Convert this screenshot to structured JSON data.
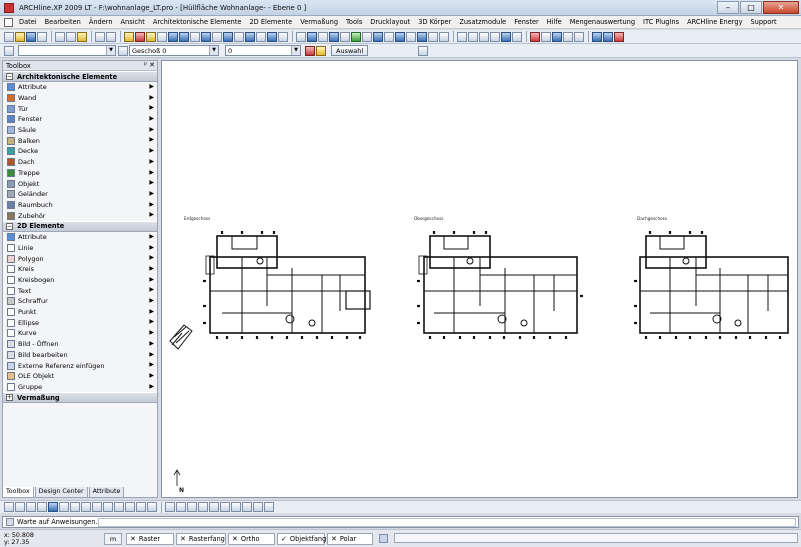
{
  "window": {
    "title": "ARCHline.XP 2009 LT - F:\\wohnanlage_LT.pro - [Hüllfläche Wohnanlage- - Ebene 0 ]",
    "controls": [
      "–",
      "□",
      "✕"
    ]
  },
  "menubar": {
    "items": [
      "Datei",
      "Bearbeiten",
      "Ändern",
      "Ansicht",
      "Architektonische Elemente",
      "2D Elemente",
      "Vermaßung",
      "Tools",
      "Drucklayout",
      "3D Körper",
      "Zusatzmodule",
      "Fenster",
      "Hilfe",
      "Mengenauswertung",
      "ITC PlugIns",
      "ARCHline Energy",
      "Support"
    ]
  },
  "toolbar2": {
    "floor_combo": "Geschoß 0",
    "layer_combo": "0",
    "selection_button": "Auswahl"
  },
  "toolbox": {
    "header": "Toolbox",
    "header_buttons": "ᵖ ✕",
    "groups": [
      {
        "title": "Architektonische Elemente",
        "toggle": "−",
        "items": [
          {
            "label": "Attribute",
            "icon": "attribute-icon",
            "color": "#5b8ed6"
          },
          {
            "label": "Wand",
            "icon": "wall-icon",
            "color": "#d36c2c"
          },
          {
            "label": "Tür",
            "icon": "door-icon",
            "color": "#7a9ad0"
          },
          {
            "label": "Fenster",
            "icon": "window-icon",
            "color": "#5a86c8"
          },
          {
            "label": "Säule",
            "icon": "column-icon",
            "color": "#9fb8de"
          },
          {
            "label": "Balken",
            "icon": "beam-icon",
            "color": "#c7b17a"
          },
          {
            "label": "Decke",
            "icon": "slab-icon",
            "color": "#3aa0a0"
          },
          {
            "label": "Dach",
            "icon": "roof-icon",
            "color": "#b0552a"
          },
          {
            "label": "Treppe",
            "icon": "stairs-icon",
            "color": "#3c8a3c"
          },
          {
            "label": "Objekt",
            "icon": "object-icon",
            "color": "#8a9ab3"
          },
          {
            "label": "Geländer",
            "icon": "railing-icon",
            "color": "#a0a8b4"
          },
          {
            "label": "Raumbuch",
            "icon": "roombook-icon",
            "color": "#6a7fa8"
          },
          {
            "label": "Zubehör",
            "icon": "accessory-icon",
            "color": "#8a7a5a"
          }
        ]
      },
      {
        "title": "2D Elemente",
        "toggle": "−",
        "items": [
          {
            "label": "Attribute",
            "icon": "attribute-icon",
            "color": "#5b8ed6"
          },
          {
            "label": "Linie",
            "icon": "line-icon",
            "color": "#ffffff"
          },
          {
            "label": "Polygon",
            "icon": "polygon-icon",
            "color": "#f0d0d0"
          },
          {
            "label": "Kreis",
            "icon": "circle-icon",
            "color": "#ffffff"
          },
          {
            "label": "Kreisbogen",
            "icon": "arc-icon",
            "color": "#ffffff"
          },
          {
            "label": "Text",
            "icon": "text-icon",
            "color": "#ffffff"
          },
          {
            "label": "Schraffur",
            "icon": "hatch-icon",
            "color": "#c8c8c8"
          },
          {
            "label": "Punkt",
            "icon": "point-icon",
            "color": "#ffffff"
          },
          {
            "label": "Ellipse",
            "icon": "ellipse-icon",
            "color": "#ffffff"
          },
          {
            "label": "Kurve",
            "icon": "curve-icon",
            "color": "#ffffff"
          },
          {
            "label": "Bild - Öffnen",
            "icon": "image-open-icon",
            "color": "#d8dfe8"
          },
          {
            "label": "Bild bearbeiten",
            "icon": "image-edit-icon",
            "color": "#d8dfe8"
          },
          {
            "label": "Externe Referenz einfügen",
            "icon": "xref-icon",
            "color": "#c9d6ea"
          },
          {
            "label": "OLE Objekt",
            "icon": "ole-icon",
            "color": "#e6c28a"
          },
          {
            "label": "Gruppe",
            "icon": "group-icon",
            "color": "#ffffff"
          }
        ]
      },
      {
        "title": "Vermaßung",
        "toggle": "+",
        "items": []
      }
    ],
    "tabs": [
      "Toolbox",
      "Design Center",
      "Attribute"
    ]
  },
  "canvas": {
    "plans": [
      {
        "label": "Erdgeschoss"
      },
      {
        "label": "Obergeschoss"
      },
      {
        "label": "Dachgeschoss"
      }
    ],
    "north_label": "N"
  },
  "commandline": {
    "prompt": "Warte auf Anweisungen..."
  },
  "statusbar": {
    "x": "x: 50.808",
    "y": "y: 27.35",
    "unit": "m",
    "toggles": [
      "Raster",
      "Rasterfang",
      "Ortho",
      "Objektfang",
      "Polar"
    ]
  }
}
